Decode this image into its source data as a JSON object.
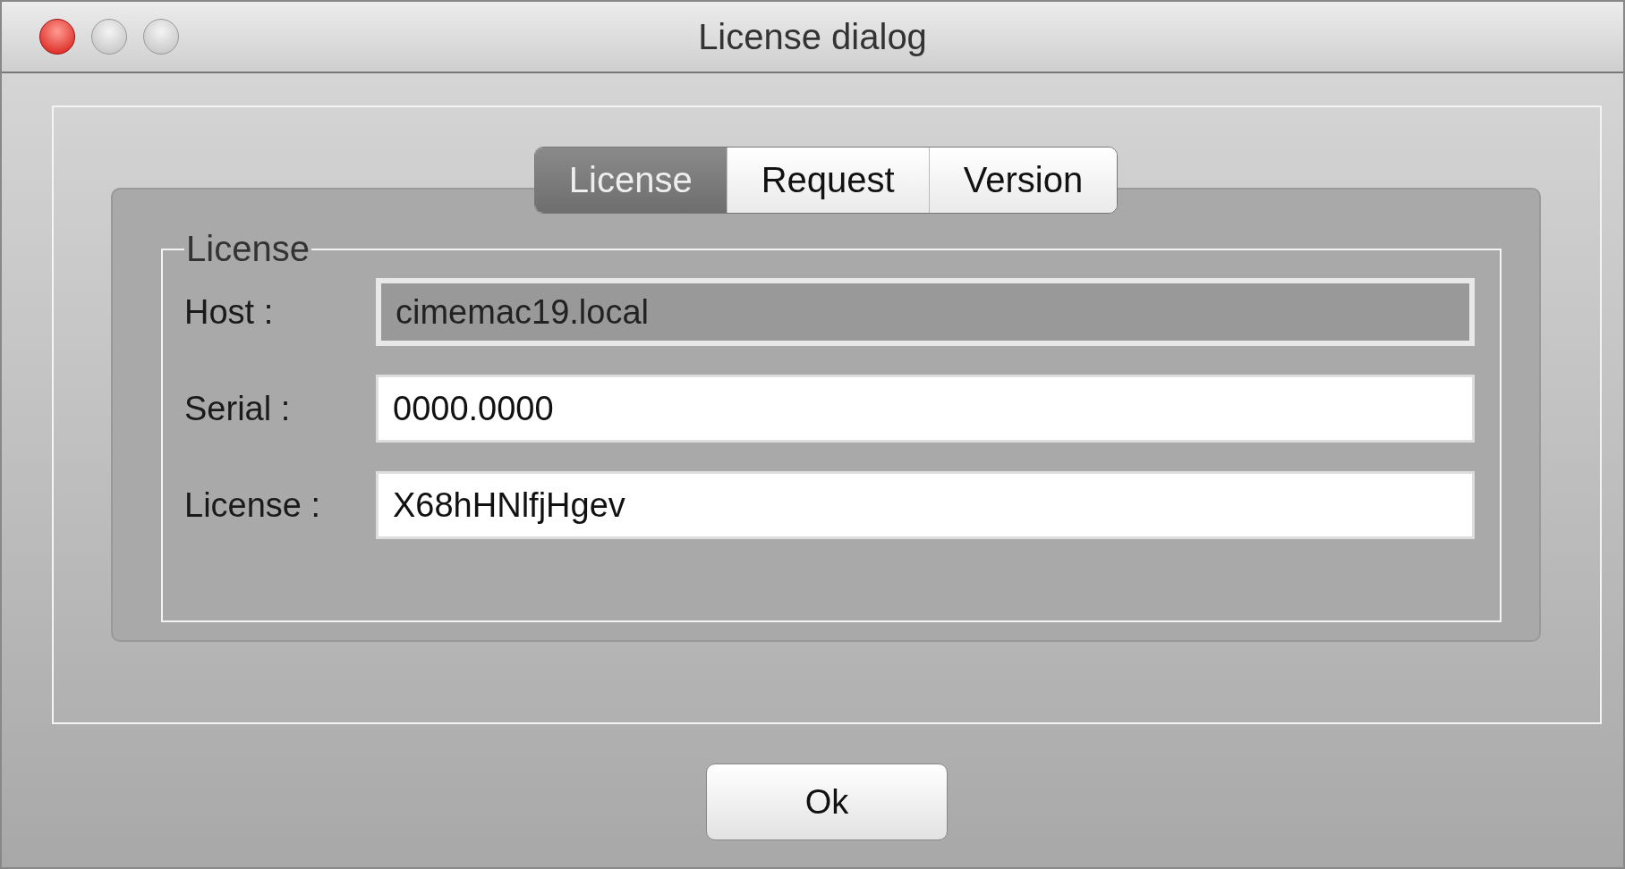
{
  "window": {
    "title": "License dialog",
    "controls": [
      {
        "kind": "close"
      },
      {
        "kind": "minimize"
      },
      {
        "kind": "zoom"
      }
    ]
  },
  "tabs": [
    {
      "label": "License",
      "selected": true
    },
    {
      "label": "Request",
      "selected": false
    },
    {
      "label": "Version",
      "selected": false
    }
  ],
  "group": {
    "title": "License",
    "fields": [
      {
        "label": "Host :",
        "value": "cimemac19.local",
        "disabled": true
      },
      {
        "label": "Serial :",
        "value": "0000.0000",
        "disabled": false
      },
      {
        "label": "License :",
        "value": "X68hHNlfjHgev",
        "disabled": false
      }
    ]
  },
  "buttons": [
    "Ok"
  ]
}
